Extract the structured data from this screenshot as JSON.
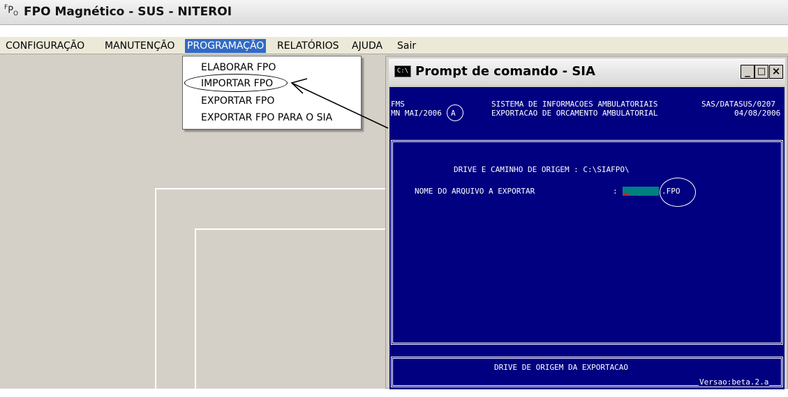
{
  "app": {
    "logo": "FPO",
    "title": "FPO Magnético - SUS -  NITEROI"
  },
  "menubar": {
    "items": [
      "CONFIGURAÇÃO",
      "MANUTENÇÃO",
      "PROGRAMAÇÃO",
      "RELATÓRIOS",
      "AJUDA",
      "Sair"
    ],
    "active": "PROGRAMAÇÃO"
  },
  "dropdown": {
    "items": [
      "ELABORAR FPO",
      "IMPORTAR FPO",
      "EXPORTAR FPO",
      "EXPORTAR FPO PARA O SIA"
    ]
  },
  "cmd": {
    "icon_text": "C:\\",
    "title": "Prompt de comando - SIA",
    "buttons": [
      "_",
      "□",
      "×"
    ],
    "header": {
      "left1": "FMS",
      "left2": "MN MAI/2006",
      "left2_letter": "A",
      "center1": "SISTEMA DE INFORMACOES AMBULATORIAIS",
      "center2": "EXPORTACAO DE ORCAMENTO AMBULATORIAL",
      "right1": "SAS/DATASUS/0207",
      "right2": "04/08/2006"
    },
    "body": {
      "drive_line": "DRIVE E CAMINHO DE ORIGEM : C:\\SIAFPO\\",
      "file_label": "NOME DO ARQUIVO A EXPORTAR",
      "colon": ":",
      "extension": ".FPO"
    },
    "status": {
      "message": "DRIVE DE ORIGEM DA EXPORTACAO",
      "version": "Versao:beta.2.a"
    }
  },
  "colors": {
    "console_bg": "#000080",
    "console_text": "#ffffff",
    "input_field": "#008080",
    "menu_highlight": "#316ac5",
    "window_face": "#d4d0c8"
  }
}
